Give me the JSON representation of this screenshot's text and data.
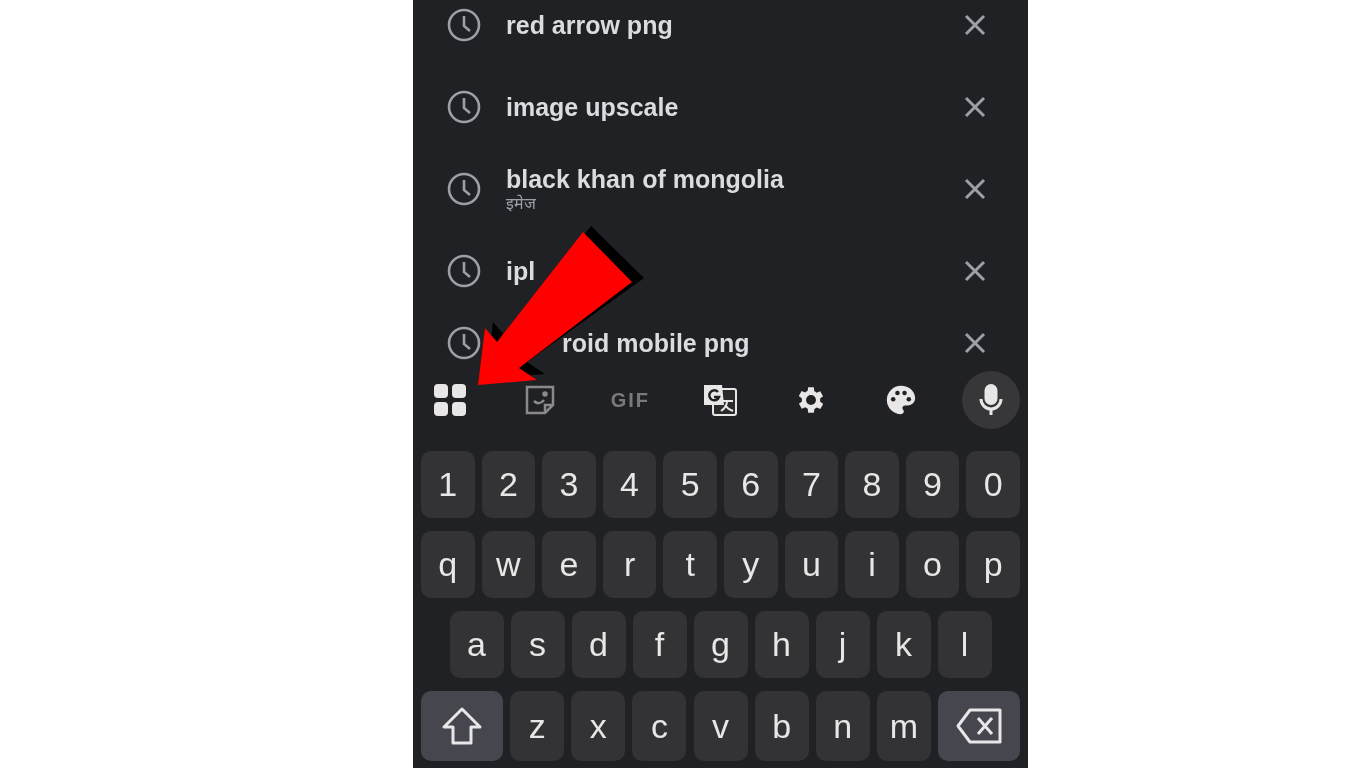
{
  "suggestions": [
    {
      "text": "red arrow png"
    },
    {
      "text": "image upscale"
    },
    {
      "text": "black khan of mongolia",
      "subtitle": "इमेज"
    },
    {
      "text": "ipl"
    },
    {
      "text": "roid mobile png"
    }
  ],
  "toolbar": [
    {
      "kind": "apps"
    },
    {
      "kind": "sticker"
    },
    {
      "kind": "text",
      "label": "GIF"
    },
    {
      "kind": "translate"
    },
    {
      "kind": "settings"
    },
    {
      "kind": "palette"
    },
    {
      "kind": "mic"
    }
  ],
  "keyboard": {
    "rows": [
      [
        "1",
        "2",
        "3",
        "4",
        "5",
        "6",
        "7",
        "8",
        "9",
        "0"
      ],
      [
        "q",
        "w",
        "e",
        "r",
        "t",
        "y",
        "u",
        "i",
        "o",
        "p"
      ],
      [
        "a",
        "s",
        "d",
        "f",
        "g",
        "h",
        "j",
        "k",
        "l"
      ],
      [
        "z",
        "x",
        "c",
        "v",
        "b",
        "n",
        "m"
      ]
    ]
  }
}
